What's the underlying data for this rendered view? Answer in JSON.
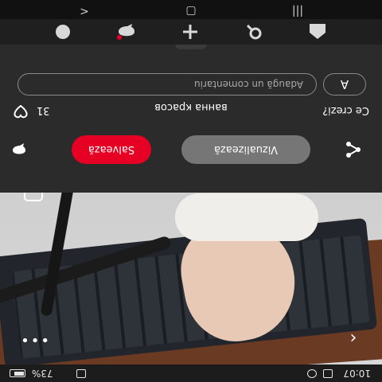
{
  "status_bar": {
    "time": "10:07",
    "battery": "73%"
  },
  "image": {
    "alt_action": "visual-search-lens"
  },
  "pin": {
    "title": "ванна красов",
    "visit_label": "Vizualizează",
    "save_label": "Salvează",
    "save_color": "#e60023",
    "visit_color": "#767676"
  },
  "comments": {
    "heading": "Ce crezi?",
    "likes": "31",
    "avatar_letter": "A",
    "input_placeholder": "Adaugă un comentariu"
  },
  "nav": {
    "items": [
      "home-icon",
      "search-icon",
      "add-icon",
      "messages-icon",
      "profile-icon"
    ]
  }
}
